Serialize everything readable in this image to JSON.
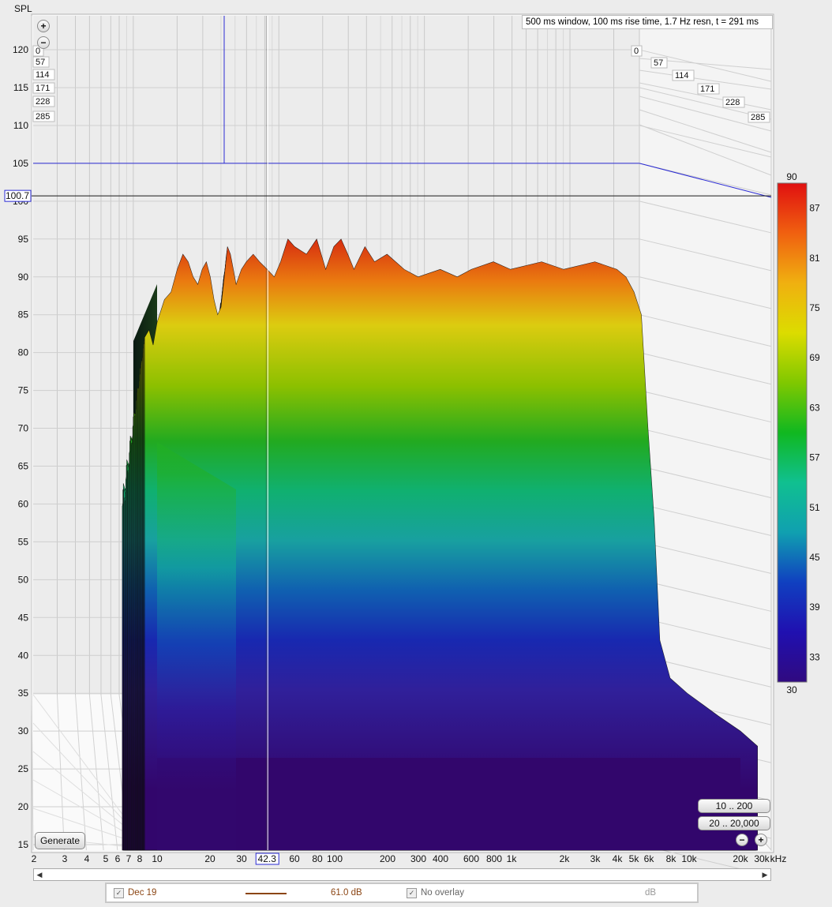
{
  "header": {
    "axis_name": "SPL",
    "info": "500 ms window, 100 ms rise time,  1.7 Hz resn, t = 291 ms"
  },
  "chart_data": {
    "type": "waterfall",
    "xlabel_unit": "kHz",
    "xscale": "log",
    "xlim": [
      2,
      30000
    ],
    "ylim": [
      14,
      125
    ],
    "y_ticks": [
      15,
      20,
      25,
      30,
      35,
      40,
      45,
      50,
      55,
      60,
      65,
      70,
      75,
      80,
      85,
      90,
      95,
      100,
      105,
      110,
      115,
      120
    ],
    "x_ticks": [
      {
        "v": 2,
        "label": "2"
      },
      {
        "v": 3,
        "label": "3"
      },
      {
        "v": 4,
        "label": "4"
      },
      {
        "v": 5,
        "label": "5"
      },
      {
        "v": 6,
        "label": "6"
      },
      {
        "v": 7,
        "label": "7"
      },
      {
        "v": 8,
        "label": "8"
      },
      {
        "v": 10,
        "label": "10"
      },
      {
        "v": 20,
        "label": "20"
      },
      {
        "v": 30,
        "label": "30"
      },
      {
        "v": 60,
        "label": "60"
      },
      {
        "v": 80,
        "label": "80"
      },
      {
        "v": 100,
        "label": "100"
      },
      {
        "v": 200,
        "label": "200"
      },
      {
        "v": 300,
        "label": "300"
      },
      {
        "v": 400,
        "label": "400"
      },
      {
        "v": 600,
        "label": "600"
      },
      {
        "v": 800,
        "label": "800"
      },
      {
        "v": 1000,
        "label": "1k"
      },
      {
        "v": 2000,
        "label": "2k"
      },
      {
        "v": 3000,
        "label": "3k"
      },
      {
        "v": 4000,
        "label": "4k"
      },
      {
        "v": 5000,
        "label": "5k"
      },
      {
        "v": 6000,
        "label": "6k"
      },
      {
        "v": 8000,
        "label": "8k"
      },
      {
        "v": 10000,
        "label": "10k"
      },
      {
        "v": 20000,
        "label": "20k"
      },
      {
        "v": 30000,
        "label": "30k"
      }
    ],
    "time_ticks_ms": [
      "0",
      "57",
      "114",
      "171",
      "228",
      "285"
    ],
    "cursor": {
      "x_label": "42.3",
      "y_label": "100.7",
      "x": 42.3,
      "y": 100.7
    },
    "reference_level": 105,
    "colorbar": {
      "min_label": "30",
      "max_label": "90",
      "labels": [
        "87",
        "81",
        "75",
        "69",
        "63",
        "57",
        "51",
        "45",
        "39",
        "33"
      ],
      "range": [
        30,
        90
      ]
    },
    "front_slice": [
      [
        8.5,
        82
      ],
      [
        9,
        83
      ],
      [
        9.5,
        81
      ],
      [
        10,
        84
      ],
      [
        11,
        87
      ],
      [
        12,
        88
      ],
      [
        13,
        91
      ],
      [
        14,
        93
      ],
      [
        15,
        92
      ],
      [
        16,
        90
      ],
      [
        17,
        89
      ],
      [
        18,
        91
      ],
      [
        19,
        92
      ],
      [
        20,
        90
      ],
      [
        21,
        87
      ],
      [
        22,
        85
      ],
      [
        23,
        86
      ],
      [
        24,
        90
      ],
      [
        25,
        94
      ],
      [
        26,
        93
      ],
      [
        27,
        91
      ],
      [
        28,
        89
      ],
      [
        30,
        91
      ],
      [
        32,
        92
      ],
      [
        35,
        93
      ],
      [
        38,
        92
      ],
      [
        42,
        91
      ],
      [
        46,
        90
      ],
      [
        50,
        92
      ],
      [
        55,
        95
      ],
      [
        60,
        94
      ],
      [
        70,
        93
      ],
      [
        80,
        95
      ],
      [
        90,
        91
      ],
      [
        100,
        94
      ],
      [
        110,
        95
      ],
      [
        120,
        93
      ],
      [
        130,
        91
      ],
      [
        150,
        94
      ],
      [
        170,
        92
      ],
      [
        200,
        93
      ],
      [
        250,
        91
      ],
      [
        300,
        90
      ],
      [
        400,
        91
      ],
      [
        500,
        90
      ],
      [
        600,
        91
      ],
      [
        800,
        92
      ],
      [
        1000,
        91
      ],
      [
        1500,
        92
      ],
      [
        2000,
        91
      ],
      [
        3000,
        92
      ],
      [
        4000,
        91
      ],
      [
        4500,
        90
      ],
      [
        5000,
        88
      ],
      [
        5500,
        85
      ],
      [
        6000,
        70
      ],
      [
        6500,
        58
      ],
      [
        7000,
        42
      ],
      [
        8000,
        37
      ],
      [
        10000,
        35
      ],
      [
        15000,
        32
      ],
      [
        20000,
        30
      ],
      [
        25000,
        28
      ]
    ]
  },
  "controls": {
    "zoom_in": "+",
    "zoom_out": "−",
    "generate": "Generate",
    "range1": "10 .. 200",
    "range2": "20 .. 20,000",
    "scroll_left": "◀",
    "scroll_right": "▶"
  },
  "legend": {
    "check1": "✓",
    "name": "Dec 19",
    "value": "61.0 dB",
    "check2": "✓",
    "overlay": "No overlay",
    "unit": "dB",
    "line_color": "#8b4513",
    "text_color": "#8b4513"
  }
}
